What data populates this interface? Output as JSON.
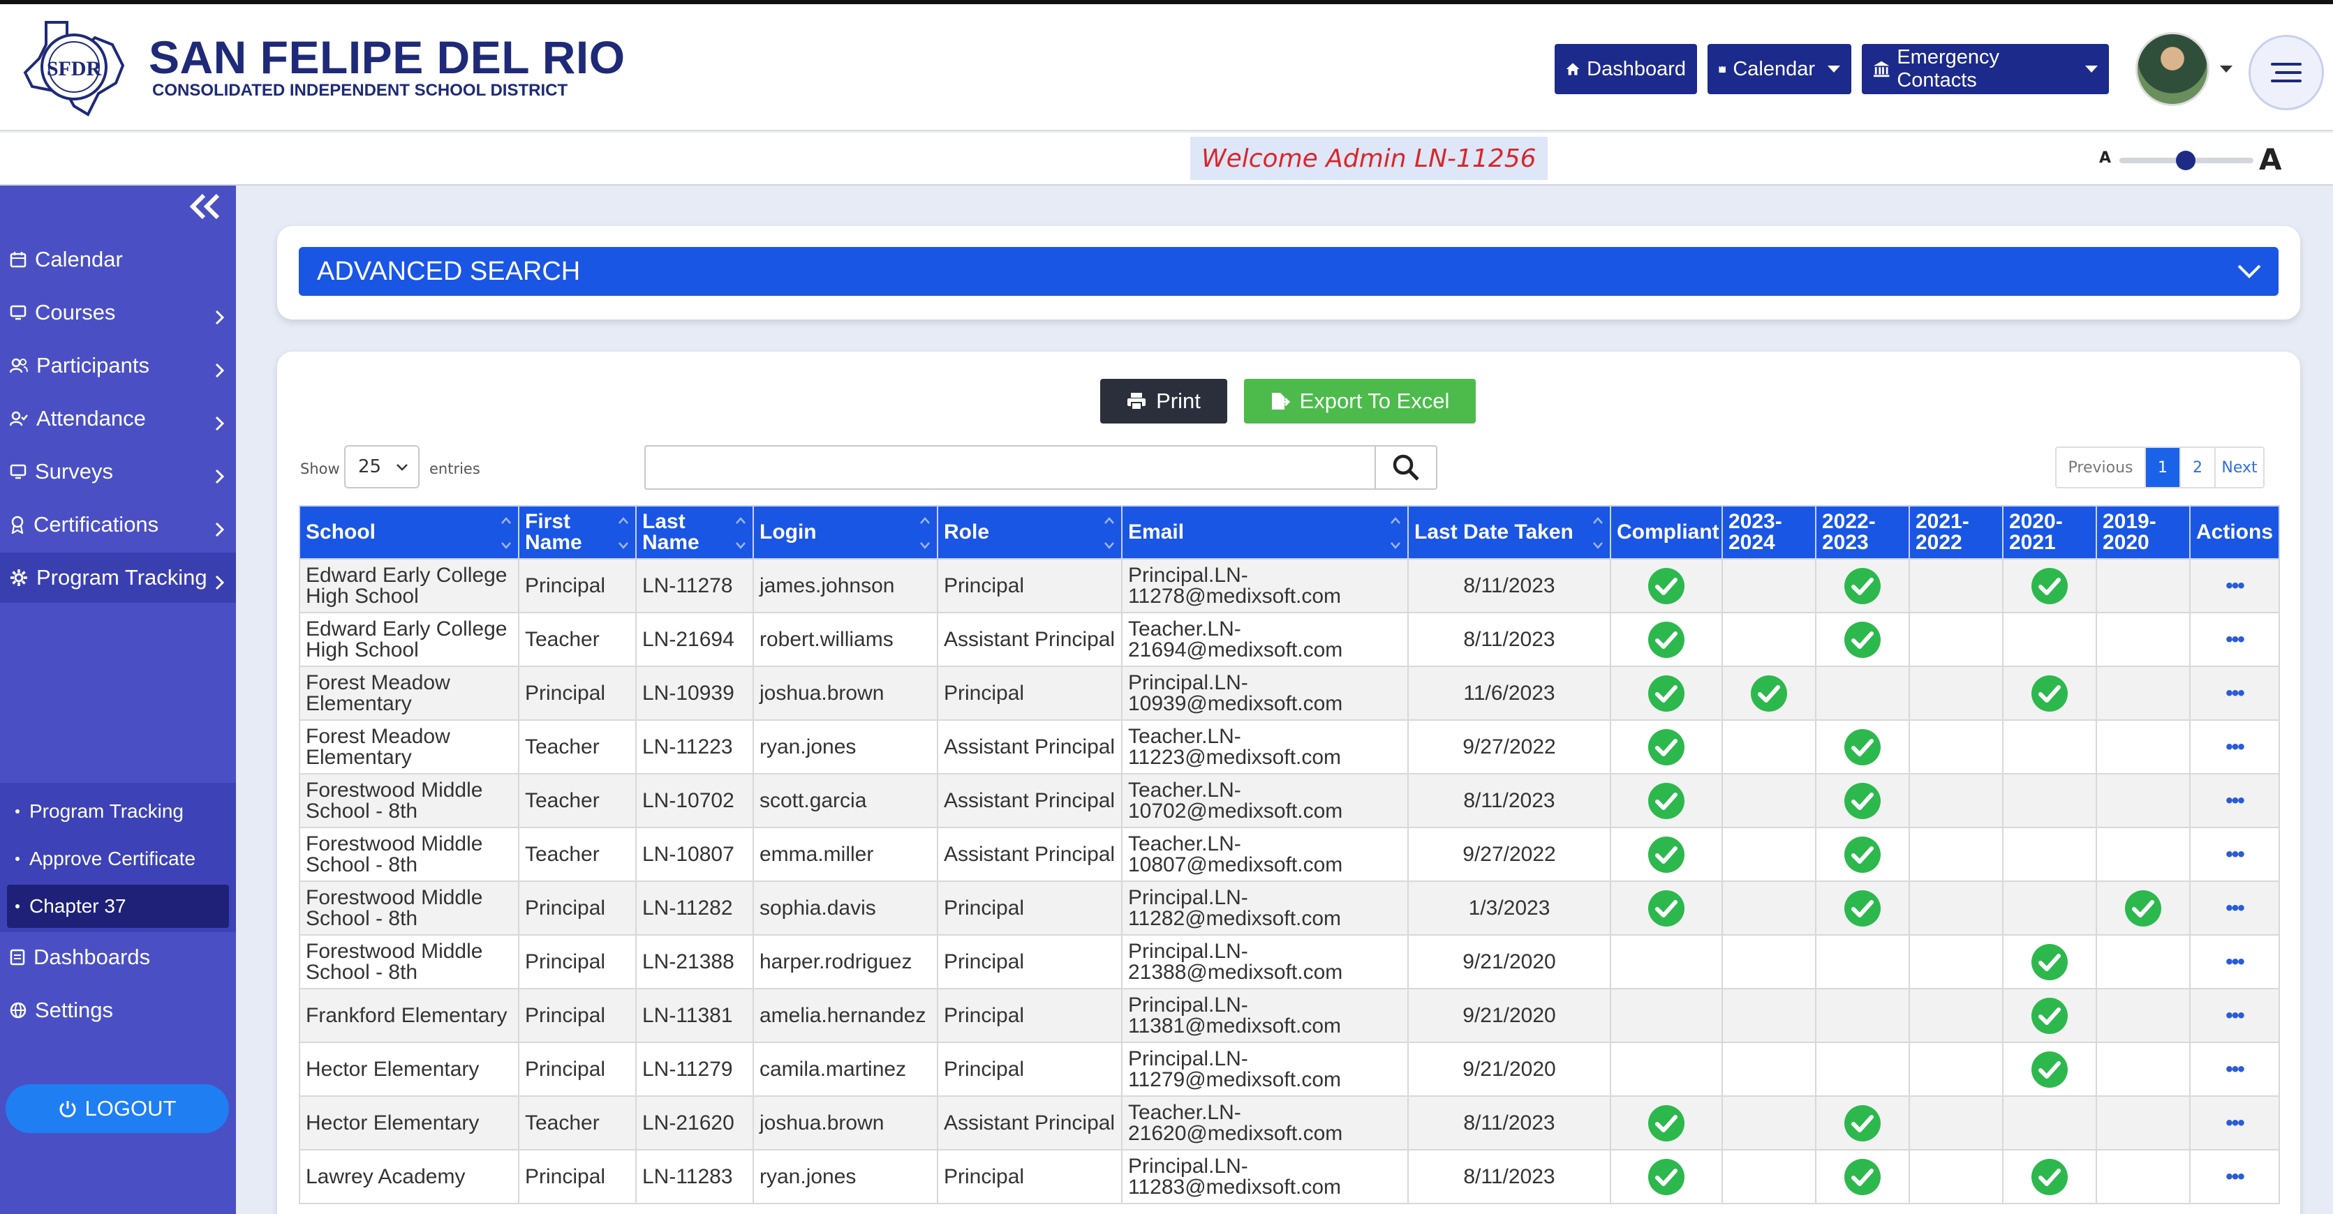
{
  "brand": {
    "title": "SAN FELIPE DEL RIO",
    "subtitle": "CONSOLIDATED INDEPENDENT SCHOOL DISTRICT",
    "logo_text": "SFDR"
  },
  "topnav": {
    "dashboard": "Dashboard",
    "calendar": "Calendar",
    "emergency": "Emergency Contacts"
  },
  "welcome": "Welcome Admin LN-11256",
  "font_size_control": {
    "small_label": "A",
    "large_label": "A",
    "level": 0.45
  },
  "sidebar": {
    "items": [
      {
        "label": "Calendar",
        "icon": "calendar-icon",
        "has_children": false
      },
      {
        "label": "Courses",
        "icon": "monitor-icon",
        "has_children": true
      },
      {
        "label": "Participants",
        "icon": "users-icon",
        "has_children": true
      },
      {
        "label": "Attendance",
        "icon": "user-check-icon",
        "has_children": true
      },
      {
        "label": "Surveys",
        "icon": "monitor-icon",
        "has_children": true
      },
      {
        "label": "Certifications",
        "icon": "award-icon",
        "has_children": true
      },
      {
        "label": "Program Tracking",
        "icon": "gear-icon",
        "has_children": true
      }
    ],
    "submenu": [
      "Program Tracking",
      "Approve Certificate",
      "Chapter 37"
    ],
    "bottom_items": [
      {
        "label": "Dashboards",
        "icon": "document-icon"
      },
      {
        "label": "Settings",
        "icon": "globe-icon"
      }
    ],
    "logout": "LOGOUT"
  },
  "advanced_search": {
    "label": "ADVANCED SEARCH"
  },
  "toolbar": {
    "print": "Print",
    "export": "Export To Excel"
  },
  "table_controls": {
    "show_label": "Show",
    "page_size": "25",
    "entries_label": "entries",
    "search_value": "",
    "pager": {
      "previous": "Previous",
      "pages": [
        "1",
        "2"
      ],
      "current": "1",
      "next": "Next"
    }
  },
  "table": {
    "headers": [
      "School",
      "First Name",
      "Last Name",
      "Login",
      "Role",
      "Email",
      "Last Date Taken",
      "Compliant",
      "2023-2024",
      "2022-2023",
      "2021-2022",
      "2020-2021",
      "2019-2020",
      "Actions"
    ],
    "rows": [
      {
        "school": "Edward Early College High School",
        "first": "Principal",
        "last": "LN-11278",
        "login": "james.johnson",
        "role": "Principal",
        "email": "Principal.LN-11278@medixsoft.com",
        "date": "8/11/2023",
        "compliant": true,
        "y2324": false,
        "y2223": true,
        "y2122": false,
        "y2021": true,
        "y1920": false
      },
      {
        "school": "Edward Early College High School",
        "first": "Teacher",
        "last": "LN-21694",
        "login": "robert.williams",
        "role": "Assistant Principal",
        "email": "Teacher.LN-21694@medixsoft.com",
        "date": "8/11/2023",
        "compliant": true,
        "y2324": false,
        "y2223": true,
        "y2122": false,
        "y2021": false,
        "y1920": false
      },
      {
        "school": "Forest Meadow Elementary",
        "first": "Principal",
        "last": "LN-10939",
        "login": "joshua.brown",
        "role": "Principal",
        "email": "Principal.LN-10939@medixsoft.com",
        "date": "11/6/2023",
        "compliant": true,
        "y2324": true,
        "y2223": false,
        "y2122": false,
        "y2021": true,
        "y1920": false
      },
      {
        "school": "Forest Meadow Elementary",
        "first": "Teacher",
        "last": "LN-11223",
        "login": "ryan.jones",
        "role": "Assistant Principal",
        "email": "Teacher.LN-11223@medixsoft.com",
        "date": "9/27/2022",
        "compliant": true,
        "y2324": false,
        "y2223": true,
        "y2122": false,
        "y2021": false,
        "y1920": false
      },
      {
        "school": "Forestwood Middle School - 8th",
        "first": "Teacher",
        "last": "LN-10702",
        "login": "scott.garcia",
        "role": "Assistant Principal",
        "email": "Teacher.LN-10702@medixsoft.com",
        "date": "8/11/2023",
        "compliant": true,
        "y2324": false,
        "y2223": true,
        "y2122": false,
        "y2021": false,
        "y1920": false
      },
      {
        "school": "Forestwood Middle School - 8th",
        "first": "Teacher",
        "last": "LN-10807",
        "login": "emma.miller",
        "role": "Assistant Principal",
        "email": "Teacher.LN-10807@medixsoft.com",
        "date": "9/27/2022",
        "compliant": true,
        "y2324": false,
        "y2223": true,
        "y2122": false,
        "y2021": false,
        "y1920": false
      },
      {
        "school": "Forestwood Middle School - 8th",
        "first": "Principal",
        "last": "LN-11282",
        "login": "sophia.davis",
        "role": "Principal",
        "email": "Principal.LN-11282@medixsoft.com",
        "date": "1/3/2023",
        "compliant": true,
        "y2324": false,
        "y2223": true,
        "y2122": false,
        "y2021": false,
        "y1920": true
      },
      {
        "school": "Forestwood Middle School - 8th",
        "first": "Principal",
        "last": "LN-21388",
        "login": "harper.rodriguez",
        "role": "Principal",
        "email": "Principal.LN-21388@medixsoft.com",
        "date": "9/21/2020",
        "compliant": false,
        "y2324": false,
        "y2223": false,
        "y2122": false,
        "y2021": true,
        "y1920": false
      },
      {
        "school": "Frankford Elementary",
        "first": "Principal",
        "last": "LN-11381",
        "login": "amelia.hernandez",
        "role": "Principal",
        "email": "Principal.LN-11381@medixsoft.com",
        "date": "9/21/2020",
        "compliant": false,
        "y2324": false,
        "y2223": false,
        "y2122": false,
        "y2021": true,
        "y1920": false
      },
      {
        "school": "Hector Elementary",
        "first": "Principal",
        "last": "LN-11279",
        "login": "camila.martinez",
        "role": "Principal",
        "email": "Principal.LN-11279@medixsoft.com",
        "date": "9/21/2020",
        "compliant": false,
        "y2324": false,
        "y2223": false,
        "y2122": false,
        "y2021": true,
        "y1920": false
      },
      {
        "school": "Hector Elementary",
        "first": "Teacher",
        "last": "LN-21620",
        "login": "joshua.brown",
        "role": "Assistant Principal",
        "email": "Teacher.LN-21620@medixsoft.com",
        "date": "8/11/2023",
        "compliant": true,
        "y2324": false,
        "y2223": true,
        "y2122": false,
        "y2021": false,
        "y1920": false
      },
      {
        "school": "Lawrey Academy",
        "first": "Principal",
        "last": "LN-11283",
        "login": "ryan.jones",
        "role": "Principal",
        "email": "Principal.LN-11283@medixsoft.com",
        "date": "8/11/2023",
        "compliant": true,
        "y2324": false,
        "y2223": true,
        "y2122": false,
        "y2021": true,
        "y1920": false
      }
    ],
    "actions_label": "•••",
    "check_color": "#2db84d"
  },
  "colors": {
    "header_navy": "#1e2a78",
    "sidebar": "#4a50c4",
    "table_header": "#1a56e4",
    "logout": "#1f7ef2",
    "export": "#4cbb4c",
    "welcome_text": "#d9262c"
  }
}
